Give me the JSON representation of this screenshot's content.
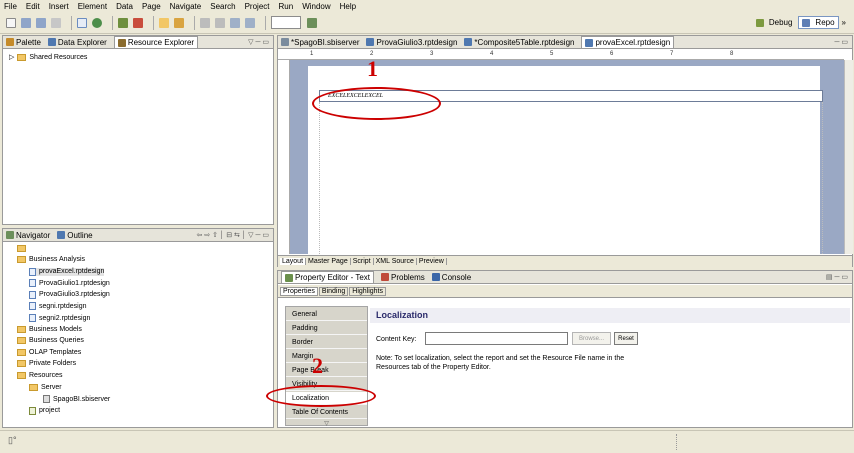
{
  "menu": [
    "File",
    "Edit",
    "Insert",
    "Element",
    "Data",
    "Page",
    "Navigate",
    "Search",
    "Project",
    "Run",
    "Window",
    "Help"
  ],
  "perspectives": [
    {
      "label": "Debug",
      "active": false
    },
    {
      "label": "Repo",
      "active": true
    }
  ],
  "perspective_more": "»",
  "top_left_view": {
    "tabs": [
      "Palette",
      "Data Explorer",
      "Resource Explorer"
    ],
    "tree": [
      "Shared Resources"
    ]
  },
  "navigator_view": {
    "tabs": [
      "Navigator",
      "Outline"
    ],
    "tree": [
      {
        "label": "Business Analysis",
        "type": "folder"
      },
      {
        "label": "provaExcel.rptdesign",
        "type": "file",
        "selected": true
      },
      {
        "label": "ProvaGiulio1.rptdesign",
        "type": "file"
      },
      {
        "label": "ProvaGiulio3.rptdesign",
        "type": "file"
      },
      {
        "label": "segni.rptdesign",
        "type": "file"
      },
      {
        "label": "segni2.rptdesign",
        "type": "file"
      },
      {
        "label": "Business Models",
        "type": "folder"
      },
      {
        "label": "Business Queries",
        "type": "folder"
      },
      {
        "label": "OLAP Templates",
        "type": "folder"
      },
      {
        "label": "Private Folders",
        "type": "folder"
      },
      {
        "label": "Resources",
        "type": "folder"
      },
      {
        "label": "Server",
        "type": "folder"
      },
      {
        "label": "SpagoBI.sbiserver",
        "type": "server"
      },
      {
        "label": "project",
        "type": "project"
      }
    ]
  },
  "editor": {
    "tabs": [
      {
        "label": "*SpagoBI.sbiserver",
        "active": false
      },
      {
        "label": "ProvaGiulio3.rptdesign",
        "active": false
      },
      {
        "label": "*Composite5Table.rptdesign",
        "active": false
      },
      {
        "label": "provaExcel.rptdesign",
        "active": true
      }
    ],
    "ruler_numbers": [
      "1",
      "2",
      "3",
      "4",
      "5",
      "6",
      "7",
      "8"
    ],
    "label_text": "EXCELEXCELEXCEL",
    "bottom_tabs": [
      "Layout",
      "Master Page",
      "Script",
      "XML Source",
      "Preview"
    ]
  },
  "property_view": {
    "tabs": [
      {
        "label": "Property Editor - Text",
        "active": true
      },
      {
        "label": "Problems",
        "active": false
      },
      {
        "label": "Console",
        "active": false
      }
    ],
    "subtabs": [
      "Properties",
      "Binding",
      "Highlights"
    ],
    "categories": [
      "General",
      "Padding",
      "Border",
      "Margin",
      "Page Break",
      "Visibility",
      "Localization",
      "Table Of Contents"
    ],
    "active_category": "Localization",
    "section_title": "Localization",
    "content_key_label": "Content Key:",
    "content_key_value": "",
    "browse_label": "Browse...",
    "reset_label": "Reset",
    "note": "Note: To set localization, select the report and set the Resource File name in the Resources tab of the Property Editor."
  },
  "annotations": [
    "1",
    "2"
  ],
  "colors": {
    "annotation_red": "#cc0000",
    "editor_background": "#9aa8c4",
    "chrome": "#ece9d8"
  }
}
